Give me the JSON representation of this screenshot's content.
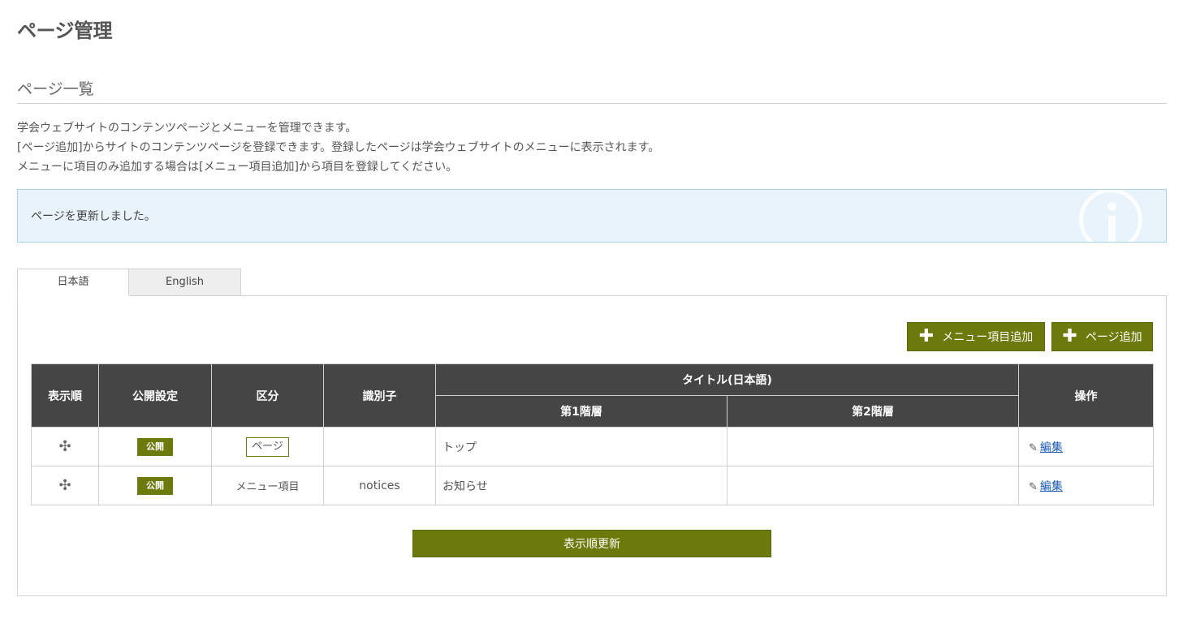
{
  "page": {
    "title": "ページ管理"
  },
  "section": {
    "title": "ページ一覧"
  },
  "description": [
    "学会ウェブサイトのコンテンツページとメニューを管理できます。",
    "[ページ追加]からサイトのコンテンツページを登録できます。登録したページは学会ウェブサイトのメニューに表示されます。",
    "メニューに項目のみ追加する場合は[メニュー項目追加]から項目を登録してください。"
  ],
  "alert": {
    "message": "ページを更新しました。",
    "icon": "info-icon"
  },
  "tabs": [
    {
      "label": "日本語",
      "active": true
    },
    {
      "label": "English",
      "active": false
    }
  ],
  "toolbar": {
    "add_menu_label": "メニュー項目追加",
    "add_page_label": "ページ追加",
    "plus_icon": "✚"
  },
  "table": {
    "headers": {
      "order": "表示順",
      "publish": "公開設定",
      "type": "区分",
      "identifier": "識別子",
      "title_group": "タイトル(日本語)",
      "level1": "第1階層",
      "level2": "第2階層",
      "actions": "操作"
    },
    "rows": [
      {
        "move_icon": "✣",
        "publish": "公開",
        "type": "ページ",
        "identifier": "",
        "level1": "トップ",
        "level2": "",
        "edit": "編集"
      },
      {
        "move_icon": "✣",
        "publish": "公開",
        "type": "メニュー項目",
        "identifier": "notices",
        "level1": "お知らせ",
        "level2": "",
        "edit": "編集"
      }
    ]
  },
  "footer": {
    "update_order_label": "表示順更新"
  },
  "colors": {
    "accent": "#6b7a0a",
    "table_header": "#454545",
    "alert_bg": "#e8f3fb",
    "link": "#1a5bb5"
  }
}
